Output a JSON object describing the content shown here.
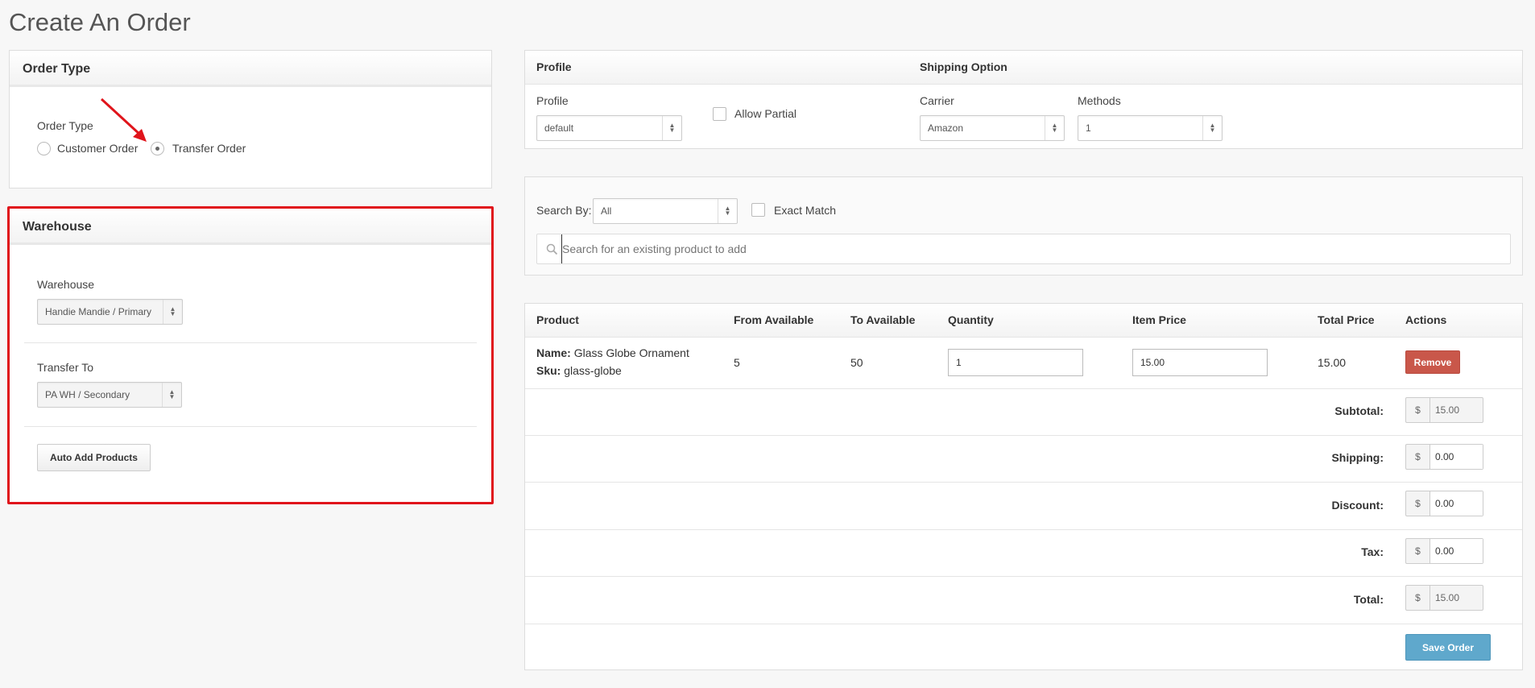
{
  "page": {
    "title": "Create An Order"
  },
  "order_type": {
    "header": "Order Type",
    "label": "Order Type",
    "options": [
      "Customer Order",
      "Transfer Order"
    ],
    "selected": "Transfer Order"
  },
  "warehouse": {
    "header": "Warehouse",
    "warehouse_label": "Warehouse",
    "warehouse_value": "Handie Mandie / Primary",
    "transfer_label": "Transfer To",
    "transfer_value": "PA WH / Secondary",
    "auto_add_button": "Auto Add Products"
  },
  "profile": {
    "header": "Profile",
    "label": "Profile",
    "value": "default",
    "allow_partial": "Allow Partial"
  },
  "shipping": {
    "header": "Shipping Option",
    "carrier_label": "Carrier",
    "carrier_value": "Amazon",
    "methods_label": "Methods",
    "methods_value": "1"
  },
  "search": {
    "search_by_label": "Search By:",
    "search_by_value": "All",
    "exact_match": "Exact Match",
    "placeholder": "Search for an existing product to add"
  },
  "table": {
    "columns": [
      "Product",
      "From Available",
      "To Available",
      "Quantity",
      "Item Price",
      "Total Price",
      "Actions"
    ],
    "rows": [
      {
        "name_label": "Name:",
        "name": "Glass Globe Ornament",
        "sku_label": "Sku:",
        "sku": "glass-globe",
        "from_available": "5",
        "to_available": "50",
        "quantity": "1",
        "item_price": "15.00",
        "total_price": "15.00",
        "remove": "Remove"
      }
    ]
  },
  "totals": {
    "currency": "$",
    "subtotal_label": "Subtotal:",
    "subtotal": "15.00",
    "shipping_label": "Shipping:",
    "shipping": "0.00",
    "discount_label": "Discount:",
    "discount": "0.00",
    "tax_label": "Tax:",
    "tax": "0.00",
    "total_label": "Total:",
    "total": "15.00"
  },
  "save_button": "Save Order",
  "colors": {
    "highlight": "#e0141b",
    "danger": "#c9574a",
    "primary": "#5fa8cc"
  },
  "icons": {
    "search": "search-icon",
    "arrow": "annotation-arrow-icon"
  }
}
